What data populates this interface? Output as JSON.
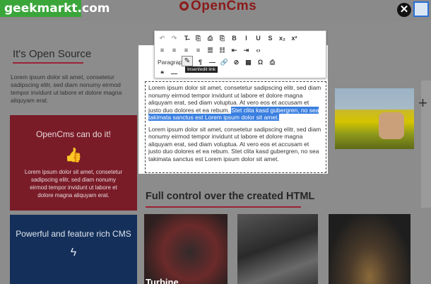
{
  "watermark": "geekmarkt.com",
  "header": {
    "logo_text": "OpenCms"
  },
  "left": {
    "heading": "It's Open Source",
    "paragraph": "Lorem ipsum dolor sit amet, consetetur sadipscing elitr, sed diam nonumy eirmod tempor invidunt ut labore et dolore magna aliquyam erat.",
    "card_red": {
      "title": "OpenCms can do it!",
      "text": "Lorem ipsum dolor sit amet, consetetur sadipscing elitr, sed diam nonumy eirmod tempor invidunt ut labore et dolore magna aliquyam erat."
    },
    "card_blue": {
      "title": "Powerful and feature rich CMS"
    }
  },
  "toolbar": {
    "format_value": "Paragraph",
    "tooltip": "Insert/edit link",
    "row1": [
      "↶",
      "↷",
      "T̶",
      "⎘",
      "⎙",
      "⎘",
      "B",
      "I",
      "U",
      "S",
      "x₂",
      "x²"
    ],
    "row2": [
      "≡",
      "≡",
      "≡",
      "≡",
      "☰",
      "☷",
      "⇤",
      "⇥",
      "‹›"
    ],
    "row3": [
      "¶",
      "—",
      "🔗",
      "⊘",
      "▦",
      "Ω",
      "⎙"
    ]
  },
  "editor": {
    "p1_a": "Lorem ipsum dolor sit amet, consetetur sadipscing elitr, sed diam nonumy eirmod tempor invidunt ut labore et dolore magna aliquyam erat, sed diam voluptua. At vero eos et accusam et justo duo dolores et ea rebum. ",
    "p1_sel": "Stet clita kasd gubergren, no sea takimata sanctus est Lorem ipsum dolor sit amet.",
    "p2": "Lorem ipsum dolor sit amet, consetetur sadipscing elitr, sed diam nonumy eirmod tempor invidunt ut labore et dolore magna aliquyam erat, sed diam voluptua. At vero eos et accusam et justo duo dolores et ea rebum. Stet clita kasd gubergren, no sea takimata sanctus est Lorem ipsum dolor sit amet."
  },
  "html_section": {
    "heading": "Full control over the created HTML",
    "caption": "Turbine"
  },
  "colors": {
    "brand_red": "#9b2335",
    "card_red": "#7a1c28",
    "card_blue": "#14305a",
    "selection": "#3a7fe0"
  }
}
